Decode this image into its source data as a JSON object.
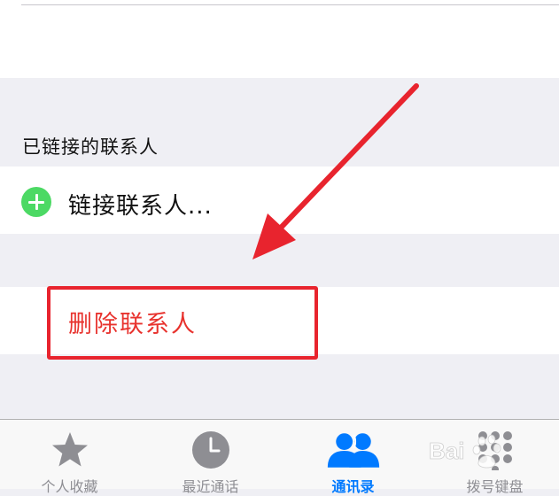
{
  "section": {
    "linked_header": "已链接的联系人"
  },
  "link_row": {
    "label": "链接联系人...",
    "icon": "plus-circle-icon",
    "icon_color": "#4cd964"
  },
  "delete_row": {
    "label": "删除联系人",
    "color": "#e8332e"
  },
  "annotation": {
    "color": "#e8242e"
  },
  "tabbar": {
    "tabs": [
      {
        "label": "个人收藏",
        "icon": "star-icon"
      },
      {
        "label": "最近通话",
        "icon": "clock-icon"
      },
      {
        "label": "通讯录",
        "icon": "people-icon",
        "active": true
      },
      {
        "label": "拨号键盘",
        "icon": "keypad-icon"
      }
    ],
    "active_color": "#007aff",
    "inactive_color": "#8e8e93"
  },
  "watermark": {
    "text": "Bai"
  }
}
